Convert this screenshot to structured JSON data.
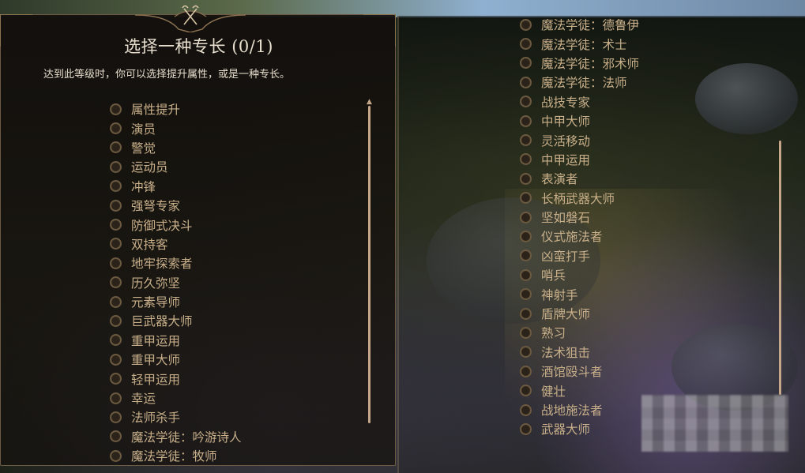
{
  "dialog": {
    "title": "选择一种专长 (0/1)",
    "subtitle": "达到此等级时，你可以选择提升属性，或是一种专长。"
  },
  "feats_left": [
    {
      "label": "属性提升"
    },
    {
      "label": "演员"
    },
    {
      "label": "警觉"
    },
    {
      "label": "运动员"
    },
    {
      "label": "冲锋"
    },
    {
      "label": "强弩专家"
    },
    {
      "label": "防御式决斗"
    },
    {
      "label": "双持客"
    },
    {
      "label": "地牢探索者"
    },
    {
      "label": "历久弥坚"
    },
    {
      "label": "元素导师"
    },
    {
      "label": "巨武器大师"
    },
    {
      "label": "重甲运用"
    },
    {
      "label": "重甲大师"
    },
    {
      "label": "轻甲运用"
    },
    {
      "label": "幸运"
    },
    {
      "label": "法师杀手"
    },
    {
      "label": "魔法学徒：吟游诗人"
    },
    {
      "label": "魔法学徒：牧师"
    }
  ],
  "feats_right": [
    {
      "label": "魔法学徒：德鲁伊"
    },
    {
      "label": "魔法学徒：术士"
    },
    {
      "label": "魔法学徒：邪术师"
    },
    {
      "label": "魔法学徒：法师"
    },
    {
      "label": "战技专家"
    },
    {
      "label": "中甲大师"
    },
    {
      "label": "灵活移动"
    },
    {
      "label": "中甲运用"
    },
    {
      "label": "表演者"
    },
    {
      "label": "长柄武器大师"
    },
    {
      "label": "坚如磐石"
    },
    {
      "label": "仪式施法者"
    },
    {
      "label": "凶蛮打手"
    },
    {
      "label": "哨兵"
    },
    {
      "label": "神射手"
    },
    {
      "label": "盾牌大师"
    },
    {
      "label": "熟习"
    },
    {
      "label": "法术狙击"
    },
    {
      "label": "酒馆殴斗者"
    },
    {
      "label": "健壮"
    },
    {
      "label": "战地施法者"
    },
    {
      "label": "武器大师"
    }
  ],
  "colors": {
    "label": "#c9b08a",
    "title": "#e8dfcf",
    "frame": "#6e5a44",
    "scrollbar": "#c7a78a"
  },
  "icons": {
    "crest": "crossed-axes-icon",
    "radio": "radio-unchecked-icon"
  }
}
